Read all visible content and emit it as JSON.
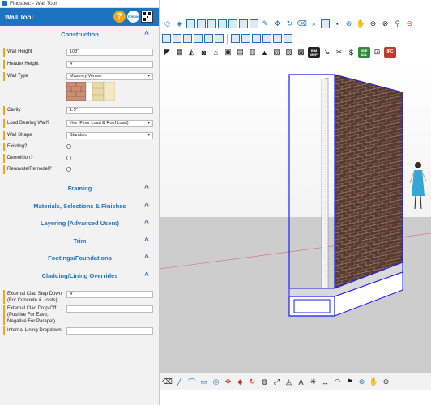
{
  "window": {
    "title": "Flucspec - Wall Tool"
  },
  "header": {
    "title": "Wall Tool",
    "help_label": "?",
    "forum_label": "FORUM"
  },
  "construction": {
    "heading": "Construction",
    "fields": [
      {
        "label": "Wall Height",
        "value": "108\""
      },
      {
        "label": "Header Height",
        "value": "4\""
      },
      {
        "label": "Wall Type",
        "value": "Masonry Veneer"
      },
      {
        "label": "Cavity",
        "value": "1.5\""
      },
      {
        "label": "Load Bearing Wall?",
        "value": "Yes (Floor Load & Roof Load)"
      },
      {
        "label": "Wall Shape",
        "value": "Standard"
      }
    ],
    "checks": [
      {
        "label": "Existing?"
      },
      {
        "label": "Demolition?"
      },
      {
        "label": "Renovate/Remodel?"
      }
    ]
  },
  "sections": [
    {
      "label": "Framing"
    },
    {
      "label": "Materials, Selections & Finishes"
    },
    {
      "label": "Layering (Advanced Users)"
    },
    {
      "label": "Trim"
    },
    {
      "label": "Footings/Foundations"
    },
    {
      "label": "Cladding/Lining Overrides"
    }
  ],
  "cladding": {
    "fields": [
      {
        "label": "External Clad Step Down\n(For Concrete & Joists)",
        "value": "4\""
      },
      {
        "label": "External Clad Drop Off\n(Positive For Eave,\nNegative For Parapet)",
        "value": ""
      },
      {
        "label": "Internal Lining Dropdown",
        "value": ""
      }
    ]
  },
  "toolbar": {
    "bim_label": "BIM\nMEP",
    "see_all_label": "SEE\nALL",
    "ifc_label": "IFC"
  },
  "colors": {
    "accent": "#1e73be",
    "orange": "#f5a21c",
    "brick": "#5a3a2c"
  }
}
